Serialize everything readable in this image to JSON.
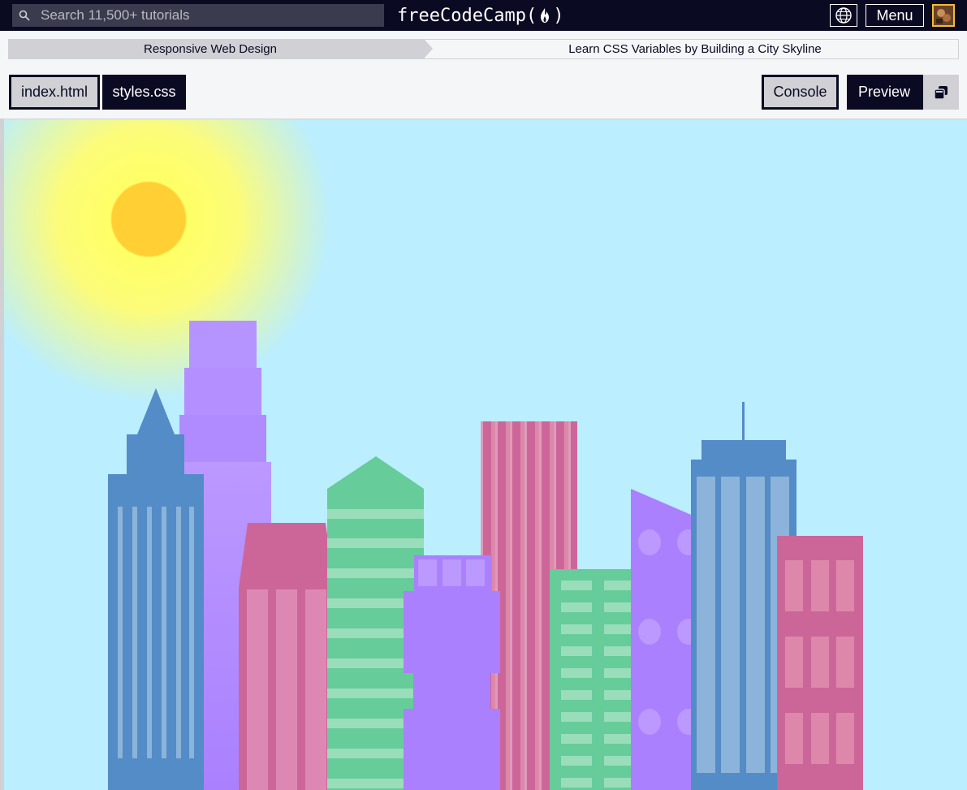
{
  "nav": {
    "search_placeholder": "Search 11,500+ tutorials",
    "logo_text": "freeCodeCamp",
    "menu_label": "Menu"
  },
  "breadcrumb": {
    "superblock": "Responsive Web Design",
    "block": "Learn CSS Variables by Building a City Skyline"
  },
  "editor_tabs": [
    {
      "label": "index.html",
      "active": false
    },
    {
      "label": "styles.css",
      "active": true
    }
  ],
  "panel_buttons": {
    "console_label": "Console",
    "preview_label": "Preview"
  },
  "colors": {
    "nav_bg": "#0a0a23",
    "sky": "#bbeefe",
    "sun": "#ffcf33",
    "sun_glow": "#ffff66",
    "building_blue": "#538cc6",
    "building_purple": "#aa80ff",
    "building_pink": "#cc6699",
    "building_green": "#66cc99"
  }
}
